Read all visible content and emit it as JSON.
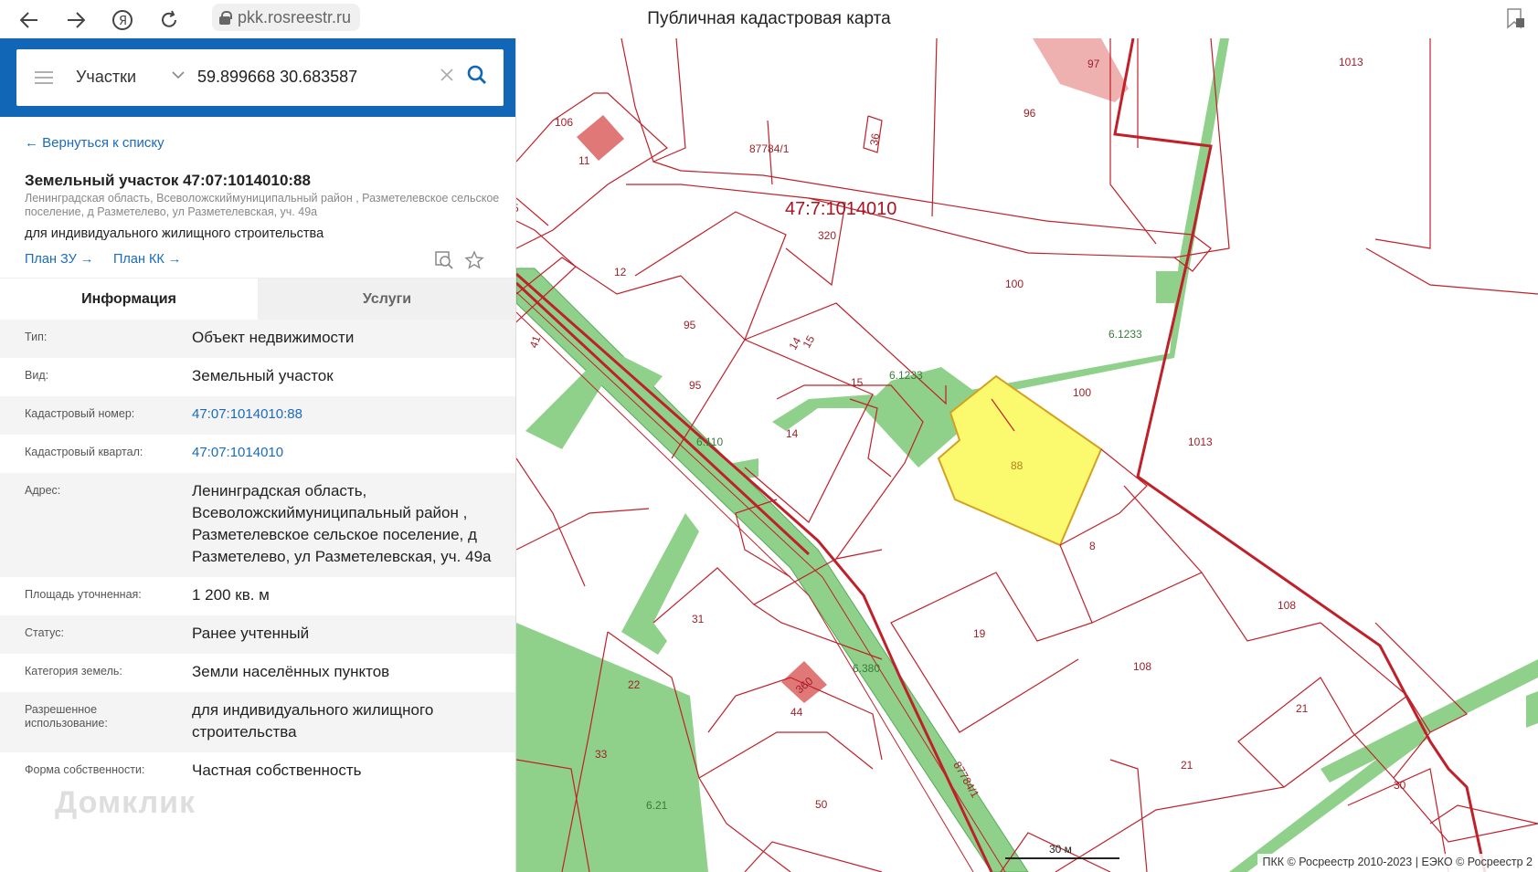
{
  "browser": {
    "back_icon": "arrow-left-icon",
    "forward_icon": "arrow-right-icon",
    "yandex_icon": "yandex-logo-icon",
    "reload_icon": "reload-icon",
    "url": "pkk.rosreestr.ru",
    "page_title": "Публичная кадастровая карта"
  },
  "search": {
    "layer": "Участки",
    "query": "59.899668 30.683587"
  },
  "card": {
    "back_label": "← Вернуться к списку",
    "title": "Земельный участок 47:07:1014010:88",
    "address": "Ленинградская область, Всеволожскиймуниципальный район , Разметелевское сельское поселение, д Разметелево, ул Разметелевская, уч. 49а",
    "permitted_use": "для индивидуального жилищного строительства",
    "plan_zu": "План ЗУ",
    "plan_kk": "План КК"
  },
  "tabs": [
    {
      "label": "Информация",
      "active": true
    },
    {
      "label": "Услуги",
      "active": false
    }
  ],
  "info_rows": [
    {
      "label": "Тип:",
      "value": "Объект недвижимости",
      "link": false
    },
    {
      "label": "Вид:",
      "value": "Земельный участок",
      "link": false
    },
    {
      "label": "Кадастровый номер:",
      "value": "47:07:1014010:88",
      "link": true
    },
    {
      "label": "Кадастровый квартал:",
      "value": "47:07:1014010",
      "link": true
    },
    {
      "label": "Адрес:",
      "value": "Ленинградская область, Всеволожскиймуниципальный район , Разметелевское сельское поселение, д Разметелево, ул Разметелевская, уч. 49а",
      "link": false
    },
    {
      "label": "Площадь уточненная:",
      "value": "1 200 кв. м",
      "link": false
    },
    {
      "label": "Статус:",
      "value": "Ранее учтенный",
      "link": false
    },
    {
      "label": "Категория земель:",
      "value": "Земли населённых пунктов",
      "link": false
    },
    {
      "label": "Разрешенное использование:",
      "value": "для индивидуального жилищного строительства",
      "link": false
    },
    {
      "label": "Форма собственности:",
      "value": "Частная собственность",
      "link": false
    }
  ],
  "watermark": "Домклик",
  "map": {
    "quarter_label": "47:7:1014010",
    "parcel_labels": [
      "97",
      "1013",
      "106",
      "96",
      "36",
      "87784/1",
      "11",
      "320",
      "5",
      "12",
      "100",
      "95",
      "41",
      "14",
      "15",
      "6.1233",
      "6.1233",
      "95",
      "15",
      "100",
      "6.110",
      "14",
      "1013",
      "88",
      "8",
      "31",
      "108",
      "19",
      "6.380",
      "108",
      "22",
      "360",
      "44",
      "21",
      "33",
      "21",
      "87784/1",
      "6.21",
      "50",
      "30"
    ],
    "scale_label": "30 м",
    "copyright": "ПКК © Росреестр 2010-2023 | ЕЭКО © Росреестр 2",
    "colors": {
      "boundary": "#c0202a",
      "road": "#8fd18a",
      "selected": "#fbfa6e",
      "building": "#e07878",
      "building_light": "#efb0b0"
    }
  }
}
